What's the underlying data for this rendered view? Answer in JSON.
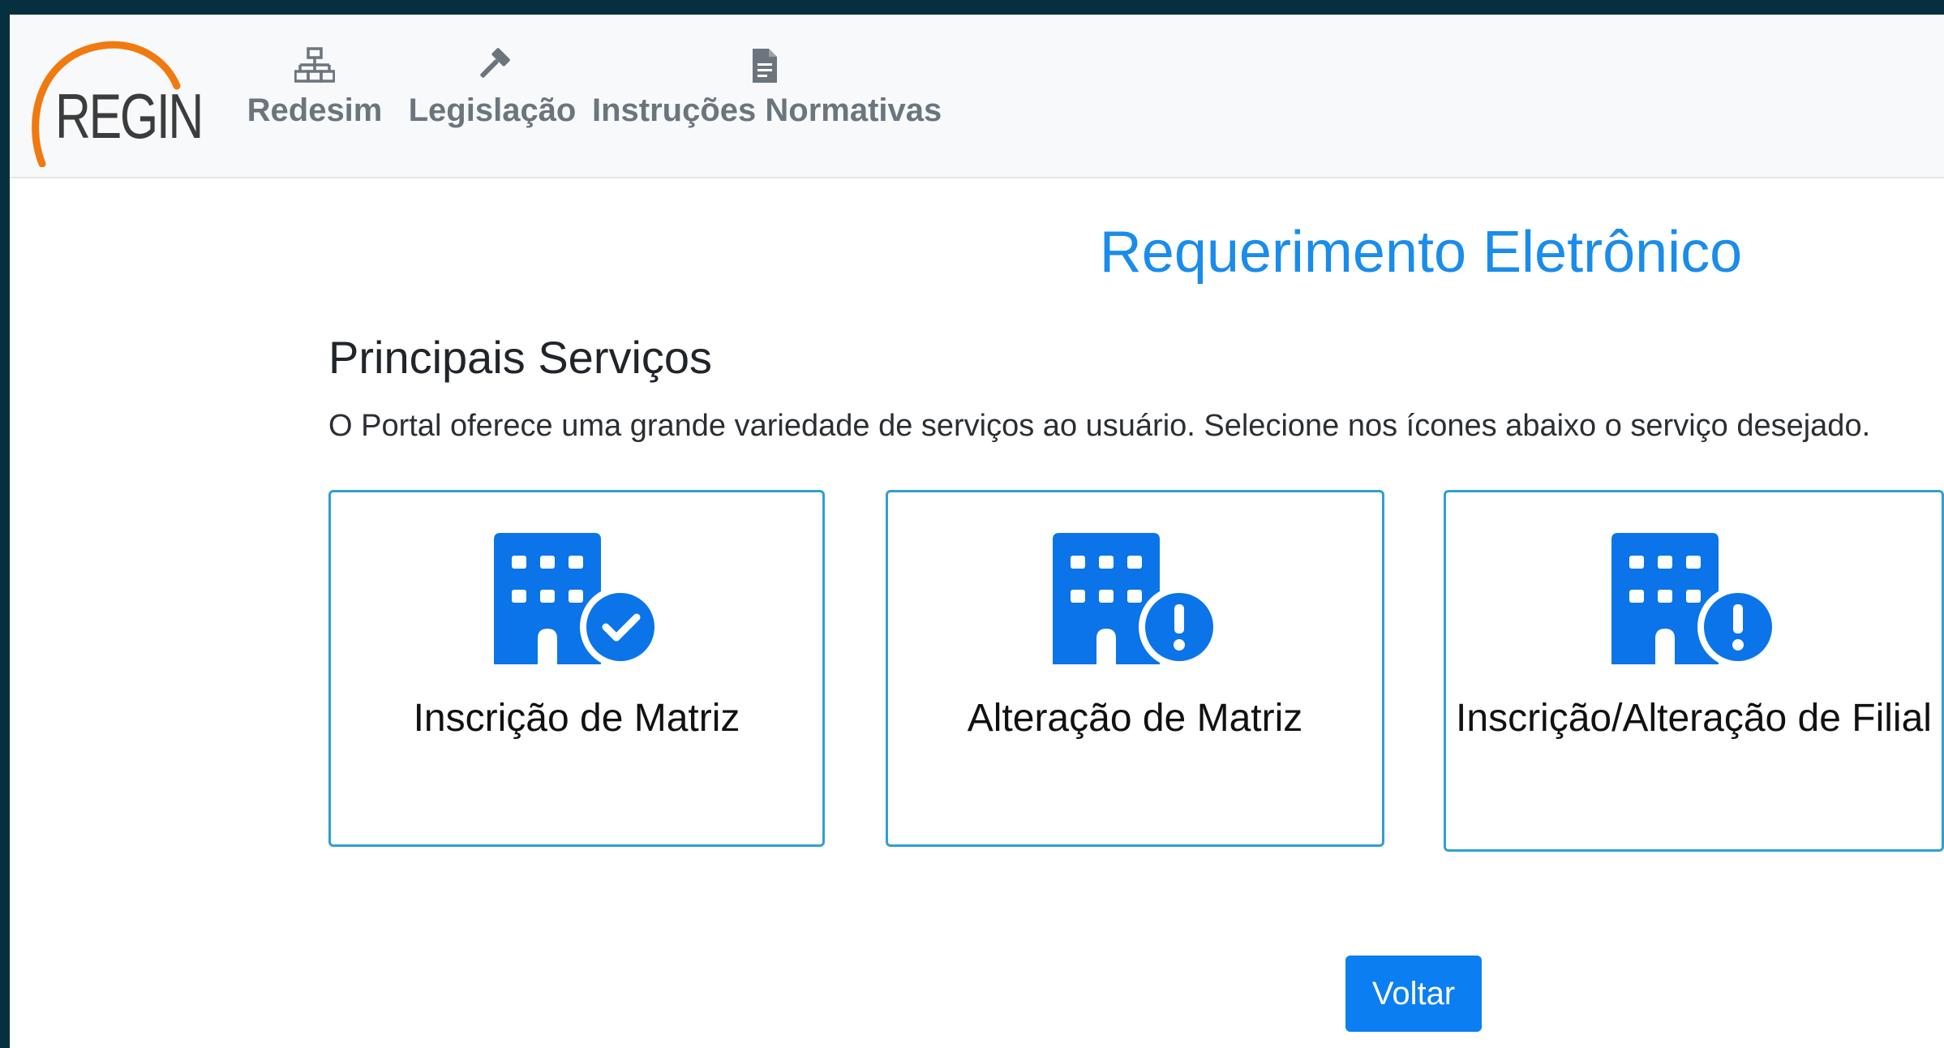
{
  "brand": {
    "logo_text": "REGIN",
    "logo_icon": "orange-arc-logo",
    "logo_arc_color": "#f07a10"
  },
  "nav": {
    "items": [
      {
        "label": "Redesim",
        "icon": "network-icon"
      },
      {
        "label": "Legislação",
        "icon": "gavel-icon"
      },
      {
        "label": "Instruções Normativas",
        "icon": "document-icon"
      }
    ]
  },
  "page": {
    "title": "Requerimento Eletrônico"
  },
  "services": {
    "title": "Principais Serviços",
    "description": "O Portal oferece uma grande variedade de serviços ao usuário. Selecione nos ícones abaixo o serviço desejado.",
    "cards": [
      {
        "label": "Inscrição de Matriz",
        "icon": "building-check-icon"
      },
      {
        "label": "Alteração de Matriz",
        "icon": "building-exclamation-icon"
      },
      {
        "label": "Inscrição/Alteração de Filial",
        "icon": "building-exclamation-icon"
      }
    ]
  },
  "actions": {
    "back_label": "Voltar"
  },
  "colors": {
    "accent": "#1a8ceb",
    "button": "#0b7ef2",
    "card_border": "#2f9fd6",
    "frame": "#06303f"
  }
}
